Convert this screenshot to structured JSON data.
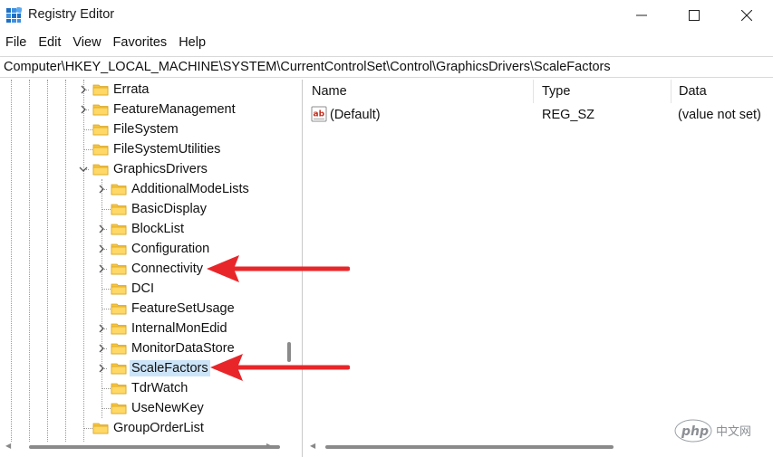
{
  "window": {
    "title": "Registry Editor",
    "minimize_icon": "minimize-icon",
    "maximize_icon": "maximize-icon",
    "close_icon": "close-icon"
  },
  "menu": [
    "File",
    "Edit",
    "View",
    "Favorites",
    "Help"
  ],
  "address": "Computer\\HKEY_LOCAL_MACHINE\\SYSTEM\\CurrentControlSet\\Control\\GraphicsDrivers\\ScaleFactors",
  "tree": {
    "items": [
      {
        "label": "Errata",
        "expander": "collapsed"
      },
      {
        "label": "FeatureManagement",
        "expander": "collapsed"
      },
      {
        "label": "FileSystem",
        "expander": "none"
      },
      {
        "label": "FileSystemUtilities",
        "expander": "none"
      },
      {
        "label": "GraphicsDrivers",
        "expander": "expanded"
      },
      {
        "label": "AdditionalModeLists",
        "expander": "collapsed"
      },
      {
        "label": "BasicDisplay",
        "expander": "none"
      },
      {
        "label": "BlockList",
        "expander": "collapsed"
      },
      {
        "label": "Configuration",
        "expander": "collapsed"
      },
      {
        "label": "Connectivity",
        "expander": "collapsed"
      },
      {
        "label": "DCI",
        "expander": "none"
      },
      {
        "label": "FeatureSetUsage",
        "expander": "none"
      },
      {
        "label": "InternalMonEdid",
        "expander": "collapsed"
      },
      {
        "label": "MonitorDataStore",
        "expander": "collapsed"
      },
      {
        "label": "ScaleFactors",
        "expander": "collapsed",
        "selected": true
      },
      {
        "label": "TdrWatch",
        "expander": "none"
      },
      {
        "label": "UseNewKey",
        "expander": "none"
      },
      {
        "label": "GroupOrderList",
        "expander": "none"
      }
    ]
  },
  "list": {
    "columns": [
      "Name",
      "Type",
      "Data"
    ],
    "rows": [
      {
        "name": "(Default)",
        "type": "REG_SZ",
        "data": "(value not set)",
        "icon": "string-value-icon"
      }
    ]
  },
  "annotations": {
    "arrow_color": "#e8262a",
    "targets": [
      "Connectivity",
      "ScaleFactors"
    ]
  },
  "watermark": {
    "logo_text": "php",
    "site_text": "中文网"
  },
  "colors": {
    "selection": "#cce4f7",
    "folder": "#f5c542"
  }
}
